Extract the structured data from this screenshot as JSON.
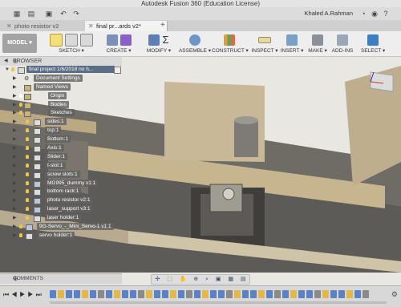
{
  "app_title": "Autodesk Fusion 360 (Education License)",
  "user_name": "Khaled A.Rahman",
  "tabs": [
    {
      "label": "photo resistor v2",
      "active": false
    },
    {
      "label": "final pr...ards v2*",
      "active": true
    }
  ],
  "ribbon": {
    "mode": "MODEL",
    "groups": [
      {
        "label": "SKETCH ▾"
      },
      {
        "label": "CREATE ▾"
      },
      {
        "label": "MODIFY ▾"
      },
      {
        "label": "ASSEMBLE ▾"
      },
      {
        "label": "CONSTRUCT ▾"
      },
      {
        "label": "INSPECT ▾"
      },
      {
        "label": "INSERT ▾"
      },
      {
        "label": "MAKE ▾"
      },
      {
        "label": "ADD-INS"
      },
      {
        "label": "SELECT ▾"
      }
    ]
  },
  "browser": {
    "title": "BROWSER",
    "root": "final project 1/6/2018 no h...",
    "items": [
      {
        "label": "Document Settings"
      },
      {
        "label": "Named Views"
      },
      {
        "label": "Origin"
      },
      {
        "label": "Bodies"
      },
      {
        "label": "Sketches"
      },
      {
        "label": "sides:1"
      },
      {
        "label": "top:1"
      },
      {
        "label": "Bottom:1"
      },
      {
        "label": "Axis:1"
      },
      {
        "label": "Slider:1"
      },
      {
        "label": "t-slot:1"
      },
      {
        "label": "screw slots:1"
      },
      {
        "label": "MG995_dummy v1:1"
      },
      {
        "label": "bottom rack:1"
      },
      {
        "label": "photo resistor v2:1"
      },
      {
        "label": "laser_support v3:1"
      },
      {
        "label": "laser holder:1"
      },
      {
        "label": "9G-Servo_-_Mini_Servo-1 v1:1"
      },
      {
        "label": "servo holder:1"
      }
    ]
  },
  "comments_label": "COMMENTS",
  "colors": {
    "ribbon_bg": "#eeeeee",
    "model_button": "#a3a3a3",
    "tree_label_bg": "#626262",
    "bulb_on": "#e8c84a",
    "select_blue": "#3c7fc2"
  }
}
